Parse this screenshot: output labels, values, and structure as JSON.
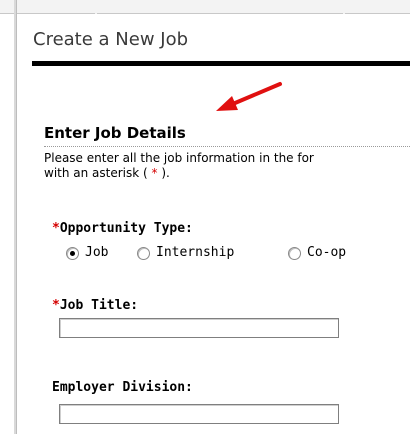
{
  "page": {
    "title": "Create a New Job"
  },
  "section": {
    "heading": "Enter Job Details",
    "instructions_line1": "Please enter all the job information in the for",
    "instructions_line2_prefix": "with an asterisk ( ",
    "instructions_star": "*",
    "instructions_line2_suffix": " )."
  },
  "fields": {
    "required_marker": "*",
    "opportunity_type": {
      "label": "Opportunity Type:",
      "options": [
        {
          "label": "Job",
          "selected": true
        },
        {
          "label": "Internship",
          "selected": false
        },
        {
          "label": "Co-op",
          "selected": false
        }
      ]
    },
    "job_title": {
      "label": "Job Title:",
      "value": ""
    },
    "employer_division": {
      "label": "Employer Division:",
      "value": ""
    }
  },
  "colors": {
    "required": "#d40000",
    "arrow": "#e01010",
    "title_rule": "#000000"
  }
}
